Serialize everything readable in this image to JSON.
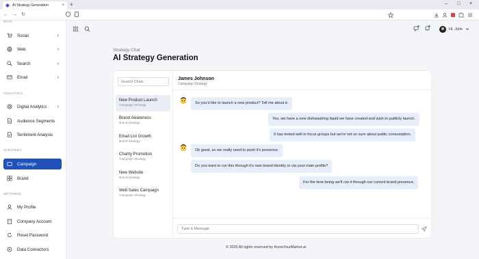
{
  "browser": {
    "tab_title": "AI Strategy Generation",
    "tab_close": "×",
    "new_tab": "+",
    "window_controls": [
      "–",
      "□",
      "×"
    ],
    "nav": [
      "←",
      "→",
      "↻"
    ]
  },
  "sidebar": {
    "sections": [
      {
        "label": "DATA",
        "items": [
          {
            "label": "Social",
            "icon": "cart-icon",
            "chevron": true
          },
          {
            "label": "Web",
            "icon": "globe-icon",
            "chevron": true
          },
          {
            "label": "Search",
            "icon": "search-icon",
            "chevron": true
          },
          {
            "label": "Email",
            "icon": "mail-icon",
            "chevron": true
          }
        ]
      },
      {
        "label": "ANALYTICS",
        "items": [
          {
            "label": "Digital Analytics",
            "icon": "target-icon",
            "chevron": true
          },
          {
            "label": "Audience Segments",
            "icon": "document-icon",
            "chevron": false
          },
          {
            "label": "Sentiment Analysis",
            "icon": "document-icon",
            "chevron": false
          }
        ]
      },
      {
        "label": "STRATEGY",
        "items": [
          {
            "label": "Campaign",
            "icon": "campaign-icon",
            "chevron": false,
            "active": true
          },
          {
            "label": "Brand",
            "icon": "grid-icon",
            "chevron": false
          }
        ]
      },
      {
        "label": "SETTINGS",
        "items": [
          {
            "label": "My Profile",
            "icon": "user-icon",
            "chevron": false
          },
          {
            "label": "Company Account",
            "icon": "building-icon",
            "chevron": false
          },
          {
            "label": "Reset Password",
            "icon": "reset-icon",
            "chevron": false
          },
          {
            "label": "Data Connectors",
            "icon": "connector-icon",
            "chevron": false
          }
        ]
      }
    ]
  },
  "header": {
    "user_greeting": "Hi, Julie",
    "kicker": "Strategy Chat",
    "title": "AI Strategy Generation"
  },
  "chat_list": {
    "search_placeholder": "Search Chats",
    "items": [
      {
        "title": "New Product Launch",
        "subtitle": "Campaign Strategy",
        "selected": true
      },
      {
        "title": "Brand Awareness",
        "subtitle": "Brand Strategy"
      },
      {
        "title": "Email List Growth",
        "subtitle": "Brand Strategy"
      },
      {
        "title": "Charity Promotion",
        "subtitle": "Campaign Strategy"
      },
      {
        "title": "New Website",
        "subtitle": "Brand Strategy"
      },
      {
        "title": "Web Sales Campaign",
        "subtitle": "Campaign Strategy"
      }
    ]
  },
  "conversation": {
    "name": "James Johnson",
    "subtitle": "Campaign Strategy",
    "messages": [
      {
        "from": "bot",
        "text": "So you'd like to launch a new product? Tell me about it."
      },
      {
        "from": "user",
        "text": "Yes, we have a new dishwashing liquid we have created and wish to publicly launch."
      },
      {
        "from": "user",
        "text": "It has tested well in focus groups but we're not so sure about public consumption."
      },
      {
        "from": "bot",
        "text": "Ok great, so we really need to push it's presence."
      },
      {
        "from": "bot",
        "text": "Do you want to run this through it's own brand identity or via your main profile?"
      },
      {
        "from": "user",
        "text": "For the time being we'll run it through our current brand presence."
      }
    ],
    "input_placeholder": "Type a Message"
  },
  "footer": "© 2025 All rights reserved by KnowYourMarket.ai",
  "colors": {
    "accent": "#2152b8",
    "bubble": "#e6eefb",
    "selected": "#e8edf8"
  }
}
